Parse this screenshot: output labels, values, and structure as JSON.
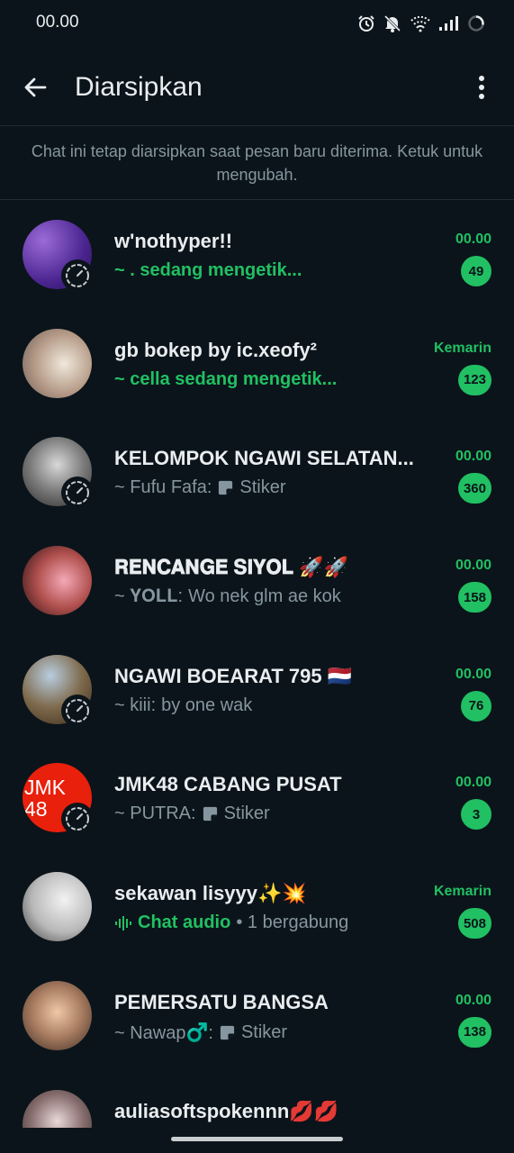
{
  "status_bar": {
    "time": "00.00"
  },
  "app_bar": {
    "title": "Diarsipkan"
  },
  "info_banner": {
    "text": "Chat ini tetap diarsipkan saat pesan baru diterima. Ketuk untuk mengubah."
  },
  "colors": {
    "background": "#0b141a",
    "accent": "#21c063",
    "secondary_text": "#8696a0",
    "primary_text": "#e9edef"
  },
  "chats": [
    {
      "name": "w'nothyper!!",
      "preview": "~ . sedang mengetik...",
      "preview_style": "typing",
      "time": "00.00",
      "unread": "49",
      "has_status_badge": true
    },
    {
      "name": "gb bokep by ic.xeofy²",
      "preview": "~ cella sedang mengetik...",
      "preview_style": "typing",
      "time": "Kemarin",
      "unread": "123",
      "has_status_badge": false
    },
    {
      "name": "KELOMPOK NGAWI SELATAN...",
      "sender": "~ Fufu Fafa:",
      "preview": "Stiker",
      "preview_style": "sticker",
      "time": "00.00",
      "unread": "360",
      "has_status_badge": true
    },
    {
      "name": "𝐑𝐄𝐍𝐂𝐀𝐍𝐆𝐄 𝐒𝐈𝐘𝐎𝐋 🚀🚀",
      "sender": "~ 𝐘𝐎𝐋𝐋:",
      "preview": "Wo nek glm ae kok",
      "preview_style": "message",
      "time": "00.00",
      "unread": "158",
      "has_status_badge": false
    },
    {
      "name": "NGAWI BOEARAT 795 🇳🇱",
      "sender": "~ kiii:",
      "preview": "by one wak",
      "preview_style": "message",
      "time": "00.00",
      "unread": "76",
      "has_status_badge": true
    },
    {
      "name": "JMK48 CABANG PUSAT",
      "sender": "~ PUTRA:",
      "preview": "Stiker",
      "preview_style": "sticker",
      "time": "00.00",
      "unread": "3",
      "has_status_badge": true,
      "avatar_text": "JMK\n48"
    },
    {
      "name": "sekawan lisyyy✨💥",
      "sender": "Chat audio",
      "preview": "• 1 bergabung",
      "preview_style": "audio",
      "time": "Kemarin",
      "unread": "508",
      "has_status_badge": false
    },
    {
      "name": "PEMERSATU BANGSA",
      "sender": "~ Nawap♂️:",
      "preview": "Stiker",
      "preview_style": "sticker",
      "time": "00.00",
      "unread": "138",
      "has_status_badge": false
    },
    {
      "name": "auliasoftspokennn💋💋",
      "sender": "",
      "preview": "",
      "preview_style": "message",
      "time": "",
      "unread": "",
      "has_status_badge": false
    }
  ]
}
